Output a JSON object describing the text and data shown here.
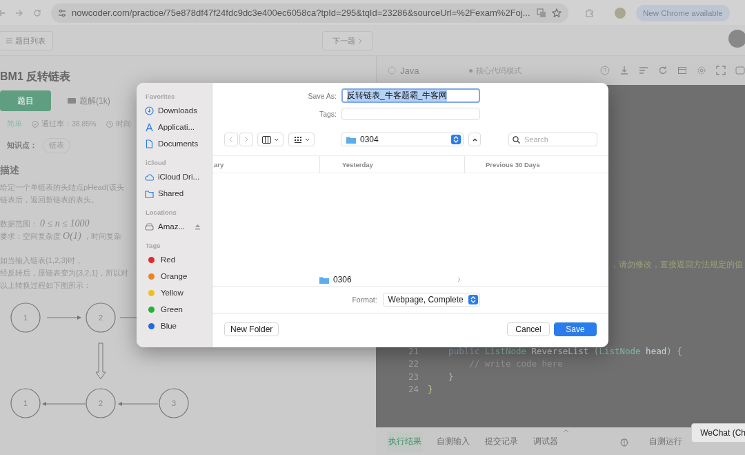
{
  "browser": {
    "url": "nowcoder.com/practice/75e878df47f24fdc9dc3e400ec6058ca?tpId=295&tqId=23286&sourceUrl=%2Fexam%2Foj...",
    "update_button": "New Chrome available"
  },
  "page_header": {
    "list_button": "题目列表",
    "next_button": "下一题"
  },
  "problem": {
    "title": "BM1  反转链表",
    "tabs": [
      {
        "label": "题目",
        "selected": true
      },
      {
        "label": "题解(1k)",
        "selected": false
      }
    ],
    "difficulty": "简单",
    "pass_rate": "通过率：38.85%",
    "time_limit": "时间",
    "knowledge_label": "知识点：",
    "knowledge_tags": [
      "链表"
    ],
    "section_title": "描述",
    "description": [
      {
        "kind": "line",
        "text": "给定一个单链表的头结点pHead(该头"
      },
      {
        "kind": "line",
        "text": "链表后，返回新链表的表头。"
      },
      {
        "kind": "gap"
      },
      {
        "kind": "line",
        "text": "数据范围： *0 ≤ n ≤ 1000*"
      },
      {
        "kind": "line",
        "text": "要求：空间复杂度 *O(1)* ，时间复杂"
      },
      {
        "kind": "gap"
      },
      {
        "kind": "line",
        "text": "如当输入链表{1,2,3}时，"
      },
      {
        "kind": "line",
        "text": "经反转后，原链表变为{3,2,1}，所以对"
      },
      {
        "kind": "line",
        "text": "以上转换过程如下图所示："
      }
    ],
    "diagram": {
      "top_nodes": [
        "1",
        "2"
      ],
      "bottom_nodes": [
        "1",
        "2",
        "3"
      ]
    }
  },
  "editor": {
    "language": "Java",
    "mode": "核心代码模式",
    "partial_comment": "，请勿修改，直接返回方法规定的值",
    "lines": [
      {
        "number": "21",
        "tokens": [
          {
            "kind": "kw",
            "text": "    public "
          },
          {
            "kind": "type",
            "text": "ListNode "
          },
          {
            "kind": "fn",
            "text": "ReverseList "
          },
          {
            "kind": "punct",
            "text": "("
          },
          {
            "kind": "type",
            "text": "ListNode "
          },
          {
            "kind": "param",
            "text": "head"
          },
          {
            "kind": "punct",
            "text": ") {"
          }
        ]
      },
      {
        "number": "22",
        "tokens": [
          {
            "kind": "comment",
            "text": "        // write code here"
          }
        ]
      },
      {
        "number": "23",
        "tokens": [
          {
            "kind": "punct",
            "text": "    }"
          }
        ]
      },
      {
        "number": "24",
        "tokens": [
          {
            "kind": "brace",
            "text": "}"
          }
        ]
      }
    ],
    "bottom_tabs": [
      {
        "label": "执行结果",
        "selected": true
      },
      {
        "label": "自测输入",
        "selected": false
      },
      {
        "label": "提交记录",
        "selected": false
      },
      {
        "label": "调试器",
        "selected": false
      }
    ],
    "run_button": "自测运行",
    "tooltip": "WeChat (Ch"
  },
  "dialog": {
    "sidebar": [
      {
        "heading": "Favorites",
        "items": [
          {
            "kind": "download",
            "label": "Downloads"
          },
          {
            "kind": "apps",
            "label": "Applicati..."
          },
          {
            "kind": "document",
            "label": "Documents"
          }
        ]
      },
      {
        "heading": "iCloud",
        "items": [
          {
            "kind": "cloud",
            "label": "iCloud Dri..."
          },
          {
            "kind": "shared",
            "label": "Shared"
          }
        ]
      },
      {
        "heading": "Locations",
        "items": [
          {
            "kind": "drive",
            "label": "Amaz..."
          }
        ]
      },
      {
        "heading": "Tags",
        "items": [
          {
            "kind": "tag",
            "label": "Red",
            "color": "#e5282e"
          },
          {
            "kind": "tag",
            "label": "Orange",
            "color": "#ef8321"
          },
          {
            "kind": "tag",
            "label": "Yellow",
            "color": "#f0bf1a"
          },
          {
            "kind": "tag",
            "label": "Green",
            "color": "#26b13a"
          },
          {
            "kind": "tag",
            "label": "Blue",
            "color": "#1f6de0"
          }
        ]
      }
    ],
    "save_as_label": "Save As:",
    "save_as_value": "反转链表_牛客题霸_牛客网",
    "tags_label": "Tags:",
    "folder": "0304",
    "search_placeholder": "Search",
    "columns": [
      "ary",
      "Yesterday",
      "Previous 30 Days"
    ],
    "folder_items": [
      "0306"
    ],
    "format_label": "Format:",
    "format_value": "Webpage, Complete",
    "new_folder_button": "New Folder",
    "cancel_button": "Cancel",
    "save_button": "Save"
  }
}
